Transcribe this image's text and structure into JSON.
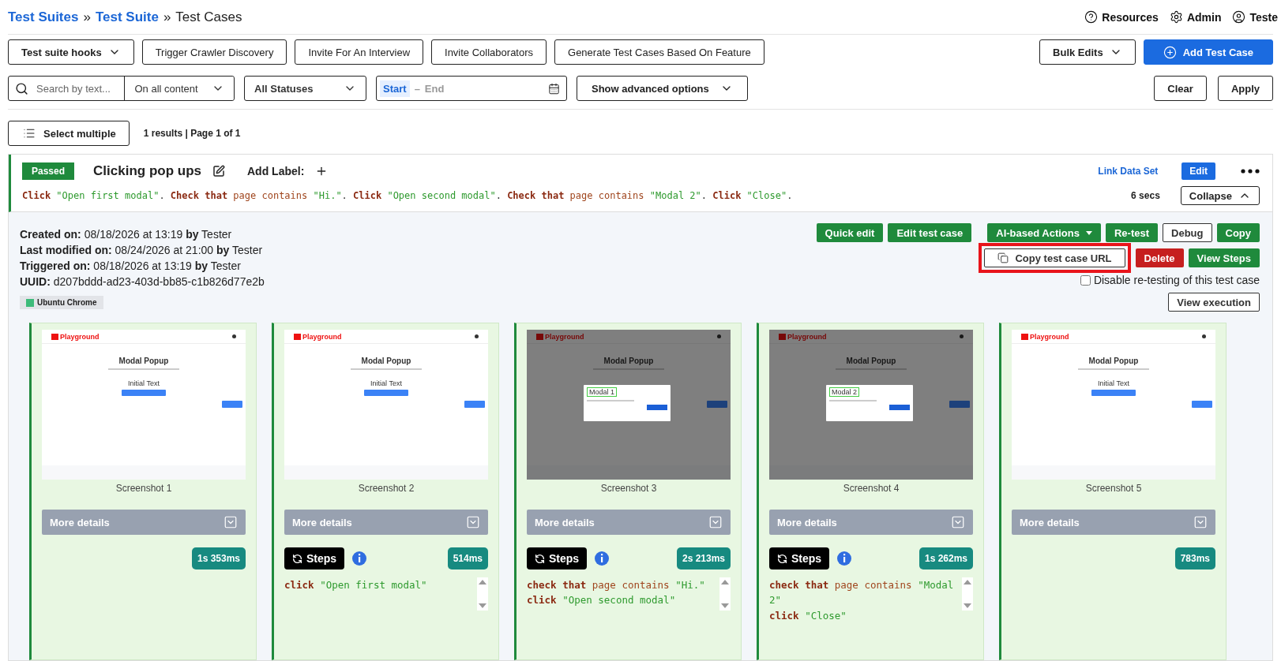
{
  "breadcrumb": [
    {
      "kind": "link",
      "text": "Test Suites"
    },
    {
      "kind": "separator",
      "text": "»"
    },
    {
      "kind": "link",
      "text": "Test Suite"
    },
    {
      "kind": "separator",
      "text": "»"
    },
    {
      "kind": "current",
      "text": "Test Cases"
    }
  ],
  "header_links": {
    "resources": "Resources",
    "admin": "Admin",
    "user": "Teste"
  },
  "toolbar": {
    "hooks": "Test suite hooks",
    "buttons": [
      "Trigger Crawler Discovery",
      "Invite For An Interview",
      "Invite Collaborators",
      "Generate Test Cases Based On Feature"
    ],
    "bulk_edits": "Bulk Edits",
    "add": "Add Test Case"
  },
  "filters": {
    "search_placeholder": "Search by text...",
    "scope": "On all content",
    "status": "All Statuses",
    "date_start": "Start",
    "date_separator": "–",
    "date_end": "End",
    "advanced": "Show advanced options",
    "clear": "Clear",
    "apply": "Apply"
  },
  "results": {
    "select_multiple": "Select multiple",
    "summary": "1 results | Page 1 of 1"
  },
  "test_case": {
    "status": "Passed",
    "title": "Clicking pop ups",
    "add_label": "Add Label:",
    "link_data_set": "Link Data Set",
    "edit": "Edit",
    "description": [
      {
        "kind": "keyword",
        "text": "Click"
      },
      {
        "kind": "string",
        "text": " \"Open first modal\""
      },
      {
        "kind": "punct",
        "text": ". "
      },
      {
        "kind": "keyword",
        "text": "Check that"
      },
      {
        "kind": "plain",
        "text": " page contains "
      },
      {
        "kind": "string",
        "text": "\"Hi.\""
      },
      {
        "kind": "punct",
        "text": ". "
      },
      {
        "kind": "keyword",
        "text": "Click"
      },
      {
        "kind": "string",
        "text": " \"Open second modal\""
      },
      {
        "kind": "punct",
        "text": ". "
      },
      {
        "kind": "keyword",
        "text": "Check that"
      },
      {
        "kind": "plain",
        "text": " page contains "
      },
      {
        "kind": "string",
        "text": "\"Modal 2\""
      },
      {
        "kind": "punct",
        "text": ". "
      },
      {
        "kind": "keyword",
        "text": "Click"
      },
      {
        "kind": "string",
        "text": " \"Close\""
      },
      {
        "kind": "punct",
        "text": "."
      }
    ],
    "duration": "6 secs",
    "collapse": "Collapse",
    "meta": [
      "**Created on:** 08/18/2026 at 13:19 **by** Tester",
      "**Last modified on:** 08/24/2026 at 21:00 **by** Tester",
      "**Triggered on:** 08/18/2026 at 13:19 **by** Tester",
      "**UUID:** d207bddd-ad23-403d-bb85-c1b826d77e2b"
    ],
    "browser": "Ubuntu Chrome",
    "action_rows": [
      [
        {
          "label": "Quick edit",
          "kind": "primary",
          "highlighted": false
        },
        {
          "label": "Edit test case",
          "kind": "primary",
          "highlighted": false
        },
        {
          "label": "AI-based Actions",
          "kind": "menu",
          "highlighted": false
        },
        {
          "label": "Re-test",
          "kind": "primary",
          "highlighted": false
        },
        {
          "label": "Debug",
          "kind": "secondary",
          "highlighted": false
        },
        {
          "label": "Copy",
          "kind": "primary",
          "highlighted": false
        }
      ],
      [
        {
          "label": "Copy test case URL",
          "kind": "copy",
          "highlighted": true
        },
        {
          "label": "Delete",
          "kind": "danger",
          "highlighted": false
        },
        {
          "label": "View Steps",
          "kind": "primary",
          "highlighted": false
        }
      ]
    ],
    "disable_retest": {
      "label": "Disable re-testing of this test case",
      "checked": false
    },
    "view_execution": "View execution",
    "screenshots": [
      {
        "caption": "Screenshot 1",
        "more_details": "More details",
        "duration": "1s 353ms",
        "thumb": {
          "logo": "Playground",
          "heading": "Modal Popup",
          "body_text": "Initial Text"
        }
      },
      {
        "caption": "Screenshot 2",
        "more_details": "More details",
        "duration": "514ms",
        "thumb": {
          "logo": "Playground",
          "heading": "Modal Popup",
          "body_text": "Initial Text"
        },
        "steps": {
          "label": "Steps",
          "lines": [
            [
              {
                "kind": "keyword",
                "text": "click"
              },
              {
                "kind": "string",
                "text": " \"Open first modal\""
              }
            ]
          ]
        }
      },
      {
        "caption": "Screenshot 3",
        "more_details": "More details",
        "duration": "2s 213ms",
        "thumb": {
          "logo": "Playground",
          "heading": "Modal Popup",
          "modal_title": "Modal 1"
        },
        "steps": {
          "label": "Steps",
          "lines": [
            [
              {
                "kind": "keyword",
                "text": "check that"
              },
              {
                "kind": "plain",
                "text": " page contains "
              },
              {
                "kind": "string",
                "text": "\"Hi.\""
              }
            ],
            [
              {
                "kind": "keyword",
                "text": "click"
              },
              {
                "kind": "string",
                "text": " \"Open second modal\""
              }
            ]
          ]
        }
      },
      {
        "caption": "Screenshot 4",
        "more_details": "More details",
        "duration": "1s 262ms",
        "thumb": {
          "logo": "Playground",
          "heading": "Modal Popup",
          "modal_title": "Modal 2"
        },
        "steps": {
          "label": "Steps",
          "lines": [
            [
              {
                "kind": "keyword",
                "text": "check that"
              },
              {
                "kind": "plain",
                "text": " page contains "
              },
              {
                "kind": "string",
                "text": "\"Modal 2\""
              }
            ],
            [
              {
                "kind": "keyword",
                "text": "click"
              },
              {
                "kind": "string",
                "text": " \"Close\""
              }
            ]
          ]
        }
      },
      {
        "caption": "Screenshot 5",
        "more_details": "More details",
        "duration": "783ms",
        "thumb": {
          "logo": "Playground",
          "heading": "Modal Popup",
          "body_text": "Initial Text"
        }
      }
    ]
  }
}
